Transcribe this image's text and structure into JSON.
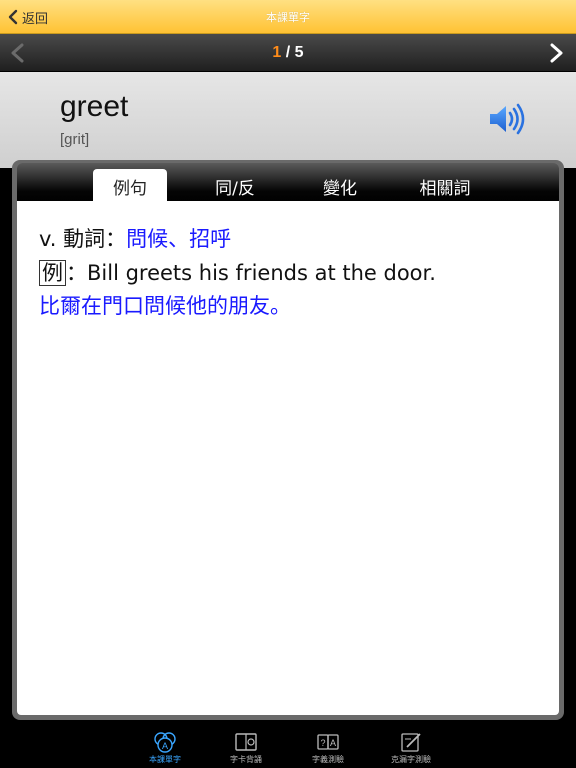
{
  "nav": {
    "back_label": "返回",
    "title": "本課單字"
  },
  "pager": {
    "current": "1",
    "separator": " / ",
    "total": "5"
  },
  "entry": {
    "word": "greet",
    "phonetic": "[grit]"
  },
  "tabs": [
    {
      "label": "例句",
      "active": true
    },
    {
      "label": "同/反",
      "active": false
    },
    {
      "label": "變化",
      "active": false
    },
    {
      "label": "相關詞",
      "active": false
    }
  ],
  "content": {
    "pos_prefix": "v. 動詞：",
    "definition": "問候、招呼",
    "example_tag": "例",
    "example_sentence": "：Bill greets his friends at the door.",
    "translation": "比爾在門口問候他的朋友。"
  },
  "bottom_tabs": [
    {
      "label": "本課單字",
      "icon": "abc-cards-icon",
      "active": true
    },
    {
      "label": "字卡背誦",
      "icon": "flashcard-book-icon",
      "active": false
    },
    {
      "label": "字義測驗",
      "icon": "quiz-cards-icon",
      "active": false
    },
    {
      "label": "克漏字測驗",
      "icon": "cloze-edit-icon",
      "active": false
    }
  ],
  "colors": {
    "accent_yellow": "#ffc233",
    "page_current": "#ff8c1a",
    "meaning_blue": "#1a1aff",
    "active_tab_blue": "#3aa6ff"
  }
}
